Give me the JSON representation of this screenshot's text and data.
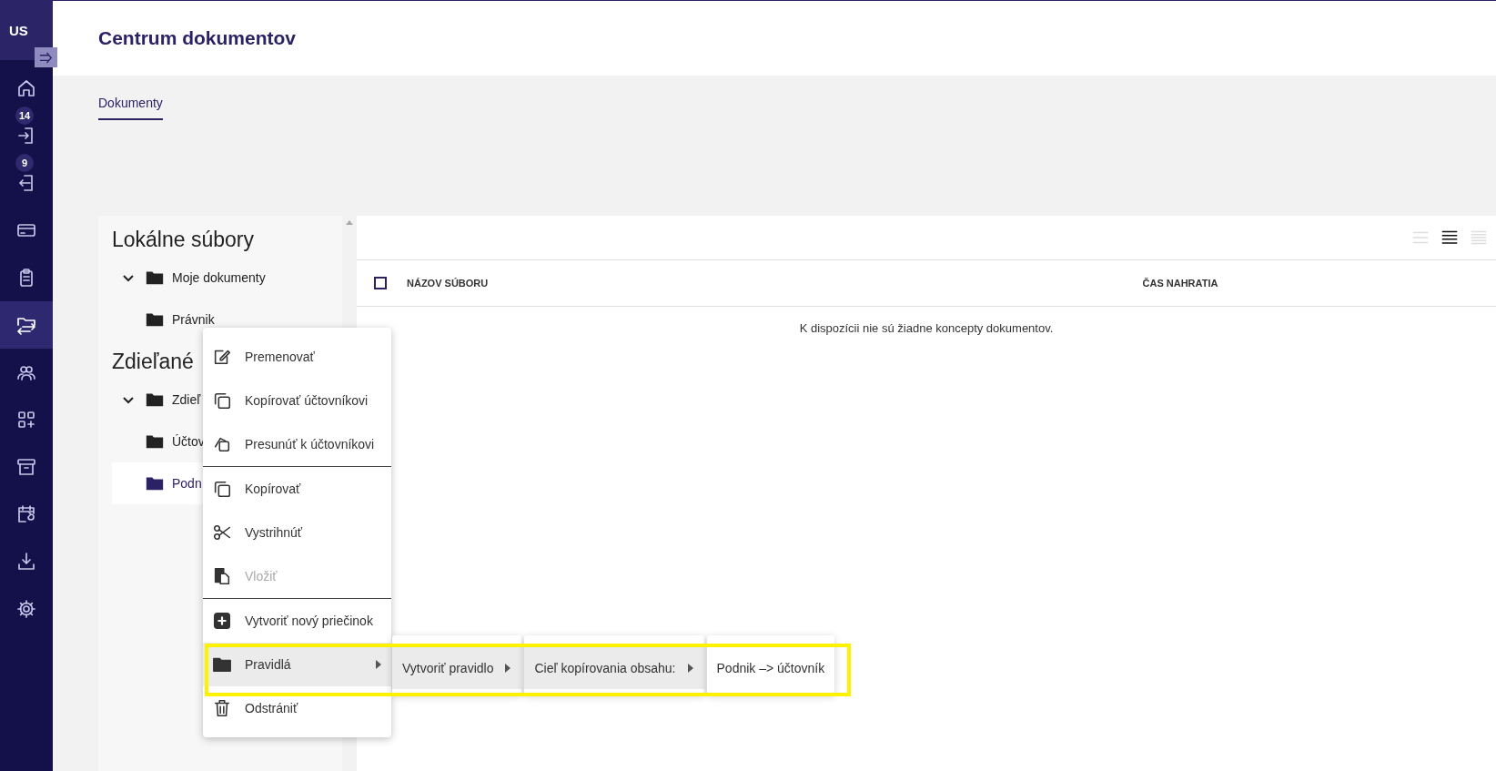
{
  "sidebar": {
    "avatar": "US",
    "items": [
      {
        "kind": "home",
        "selected": false
      },
      {
        "kind": "incoming",
        "selected": false,
        "badge": "14"
      },
      {
        "kind": "outgoing",
        "selected": false,
        "badge": "9"
      },
      {
        "kind": "card",
        "selected": false
      },
      {
        "kind": "clipboard",
        "selected": false
      },
      {
        "kind": "transfer",
        "selected": true
      },
      {
        "kind": "users",
        "selected": false
      },
      {
        "kind": "apps",
        "selected": false
      },
      {
        "kind": "archive",
        "selected": false
      },
      {
        "kind": "calendar",
        "selected": false
      },
      {
        "kind": "download",
        "selected": false
      },
      {
        "kind": "settings",
        "selected": false
      }
    ]
  },
  "header": {
    "title": "Centrum dokumentov"
  },
  "tabs": [
    {
      "label": "Dokumenty",
      "selected": true
    }
  ],
  "tree": {
    "sections": [
      {
        "title": "Lokálne súbory",
        "folders": [
          {
            "label": "Moje dokumenty",
            "expanded": true,
            "selected": false,
            "children": [
              {
                "label": "Právnik",
                "selected": false
              }
            ]
          }
        ]
      },
      {
        "title": "Zdieľané",
        "folders": [
          {
            "label": "Zdieľ",
            "expanded": true,
            "selected": false,
            "children": [
              {
                "label": "Účtov",
                "selected": false
              },
              {
                "label": "Podn",
                "selected": true
              }
            ]
          }
        ]
      }
    ]
  },
  "table": {
    "views": [
      {
        "kind": "compact",
        "selected": false
      },
      {
        "kind": "normal",
        "selected": true
      },
      {
        "kind": "dense",
        "selected": false
      }
    ],
    "select_all": {
      "checked": false
    },
    "columns": [
      "NÁZOV SÚBORU",
      "ČAS NAHRATIA"
    ],
    "empty_message": "K dispozícii nie sú žiadne koncepty dokumentov."
  },
  "context_menu": {
    "items": [
      {
        "kind": "edit",
        "label": "Premenovať",
        "disabled": false,
        "selected": false,
        "submenu": false
      },
      {
        "kind": "copy",
        "label": "Kopírovať účtovníkovi",
        "disabled": false,
        "selected": false,
        "submenu": false
      },
      {
        "kind": "move",
        "label": "Presunúť k účtovníkovi",
        "disabled": false,
        "selected": false,
        "submenu": false
      },
      {
        "kind": "divider"
      },
      {
        "kind": "copy",
        "label": "Kopírovať",
        "disabled": false,
        "selected": false,
        "submenu": false
      },
      {
        "kind": "scissors",
        "label": "Vystrihnúť",
        "disabled": false,
        "selected": false,
        "submenu": false
      },
      {
        "kind": "paste",
        "label": "Vložiť",
        "disabled": true,
        "selected": false,
        "submenu": false
      },
      {
        "kind": "divider"
      },
      {
        "kind": "plus",
        "label": "Vytvoriť nový priečinok",
        "disabled": false,
        "selected": false,
        "submenu": false
      },
      {
        "kind": "folder",
        "label": "Pravidlá",
        "disabled": false,
        "selected": true,
        "submenu": true
      },
      {
        "kind": "trash",
        "label": "Odstrániť",
        "disabled": false,
        "selected": false,
        "submenu": false
      }
    ]
  },
  "submenus": [
    {
      "items": [
        {
          "label": "Vytvoriť pravidlo",
          "selected": true,
          "submenu": true
        }
      ]
    },
    {
      "items": [
        {
          "label": "Cieľ kopírovania obsahu:",
          "selected": true,
          "submenu": true
        }
      ]
    },
    {
      "items": [
        {
          "label": "Podnik –> účtovník",
          "selected": false,
          "submenu": false
        }
      ]
    }
  ],
  "annotation": {
    "kind": "highlight"
  }
}
